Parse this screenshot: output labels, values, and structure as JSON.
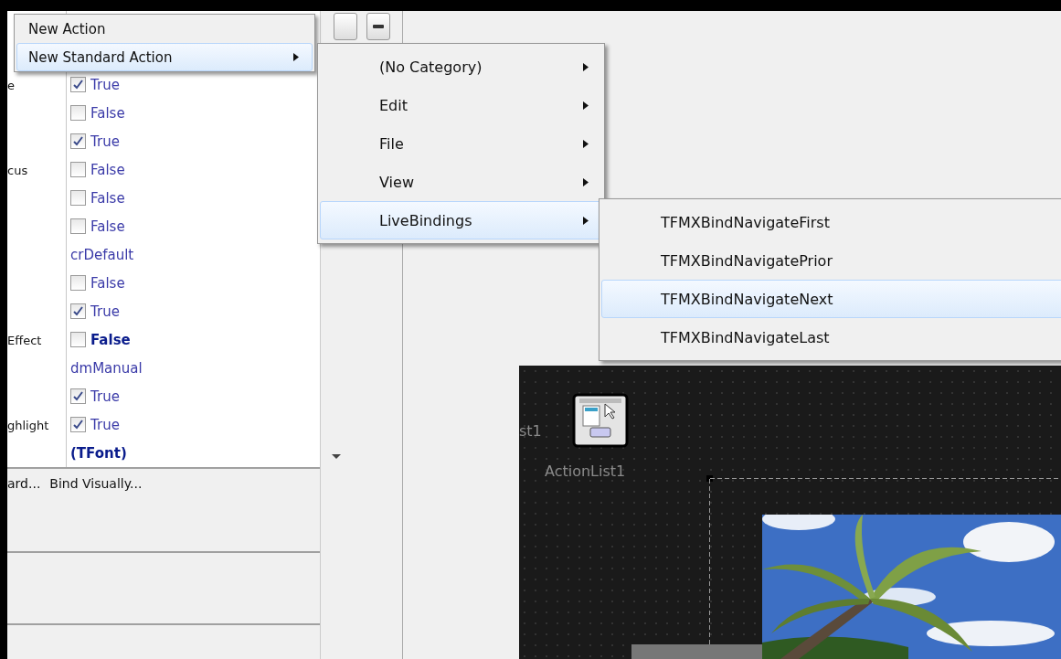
{
  "properties": [
    {
      "name": "e",
      "kind": "checkbox",
      "checked": true,
      "value": "True",
      "bold": false
    },
    {
      "kind": "checkbox",
      "checked": false,
      "value": "False",
      "bold": false
    },
    {
      "kind": "checkbox",
      "checked": true,
      "value": "True",
      "bold": false
    },
    {
      "name": "cus",
      "kind": "checkbox",
      "checked": false,
      "value": "False",
      "bold": false
    },
    {
      "kind": "checkbox",
      "checked": false,
      "value": "False",
      "bold": false
    },
    {
      "kind": "checkbox",
      "checked": false,
      "value": "False",
      "bold": false
    },
    {
      "kind": "text",
      "value": "crDefault",
      "bold": false
    },
    {
      "kind": "checkbox",
      "checked": false,
      "value": "False",
      "bold": false
    },
    {
      "kind": "checkbox",
      "checked": true,
      "value": "True",
      "bold": false
    },
    {
      "name": "Effect",
      "kind": "checkbox",
      "checked": false,
      "value": "False",
      "bold": true
    },
    {
      "kind": "text",
      "value": "dmManual",
      "bold": false
    },
    {
      "kind": "checkbox",
      "checked": true,
      "value": "True",
      "bold": false
    },
    {
      "name": "ghlight",
      "kind": "checkbox",
      "checked": true,
      "value": "True",
      "bold": false
    },
    {
      "kind": "text",
      "value": "(TFont)",
      "bold": true
    }
  ],
  "property_verbs": [
    "ard...",
    "Bind Visually..."
  ],
  "context_menu": [
    {
      "label": "New Action",
      "selected": false,
      "submenu": false
    },
    {
      "label": "New Standard Action",
      "selected": true,
      "submenu": true
    }
  ],
  "category_menu": [
    {
      "label": "(No Category)",
      "selected": false,
      "submenu": true
    },
    {
      "label": "Edit",
      "selected": false,
      "submenu": true
    },
    {
      "label": "File",
      "selected": false,
      "submenu": true
    },
    {
      "label": "View",
      "selected": false,
      "submenu": true
    },
    {
      "label": "LiveBindings",
      "selected": true,
      "submenu": true
    }
  ],
  "action_menu": [
    {
      "label": "TFMXBindNavigateFirst",
      "selected": false
    },
    {
      "label": "TFMXBindNavigatePrior",
      "selected": false
    },
    {
      "label": "TFMXBindNavigateNext",
      "selected": true
    },
    {
      "label": "TFMXBindNavigateLast",
      "selected": false
    }
  ],
  "designer": {
    "components": [
      {
        "kind": "cut",
        "label": "st1"
      },
      {
        "kind": "action-list",
        "label": "ActionList1"
      }
    ]
  }
}
